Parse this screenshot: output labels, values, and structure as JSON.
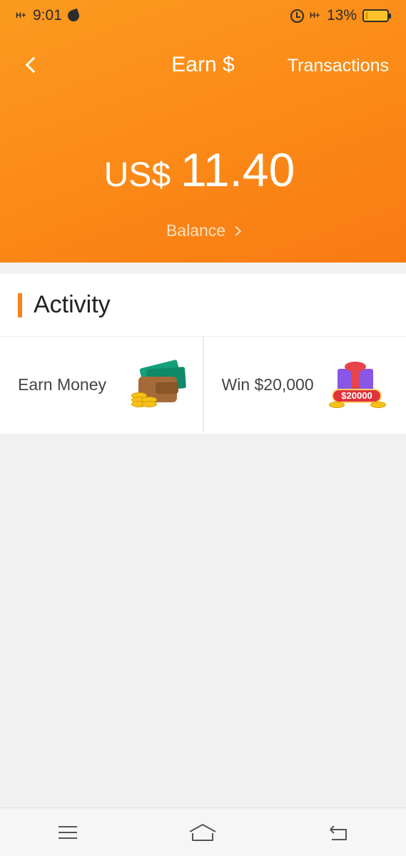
{
  "status_bar": {
    "time": "9:01",
    "battery": "13%",
    "network_left": "H+",
    "network_right": "H+"
  },
  "header": {
    "title": "Earn $",
    "transactions_label": "Transactions",
    "currency": "US$",
    "amount": "11.40",
    "balance_label": "Balance",
    "gradient_colors": [
      "#fb9a1f",
      "#f97a12"
    ]
  },
  "activity": {
    "title": "Activity",
    "accent_color": "#f7831a",
    "tiles": [
      {
        "label": "Earn Money",
        "icon": "wallet-coins-icon"
      },
      {
        "label": "Win $20,000",
        "icon": "gift-prize-icon",
        "badge": "$20000"
      }
    ]
  },
  "system_nav": {
    "icons": [
      "menu-icon",
      "home-icon",
      "back-icon"
    ]
  }
}
